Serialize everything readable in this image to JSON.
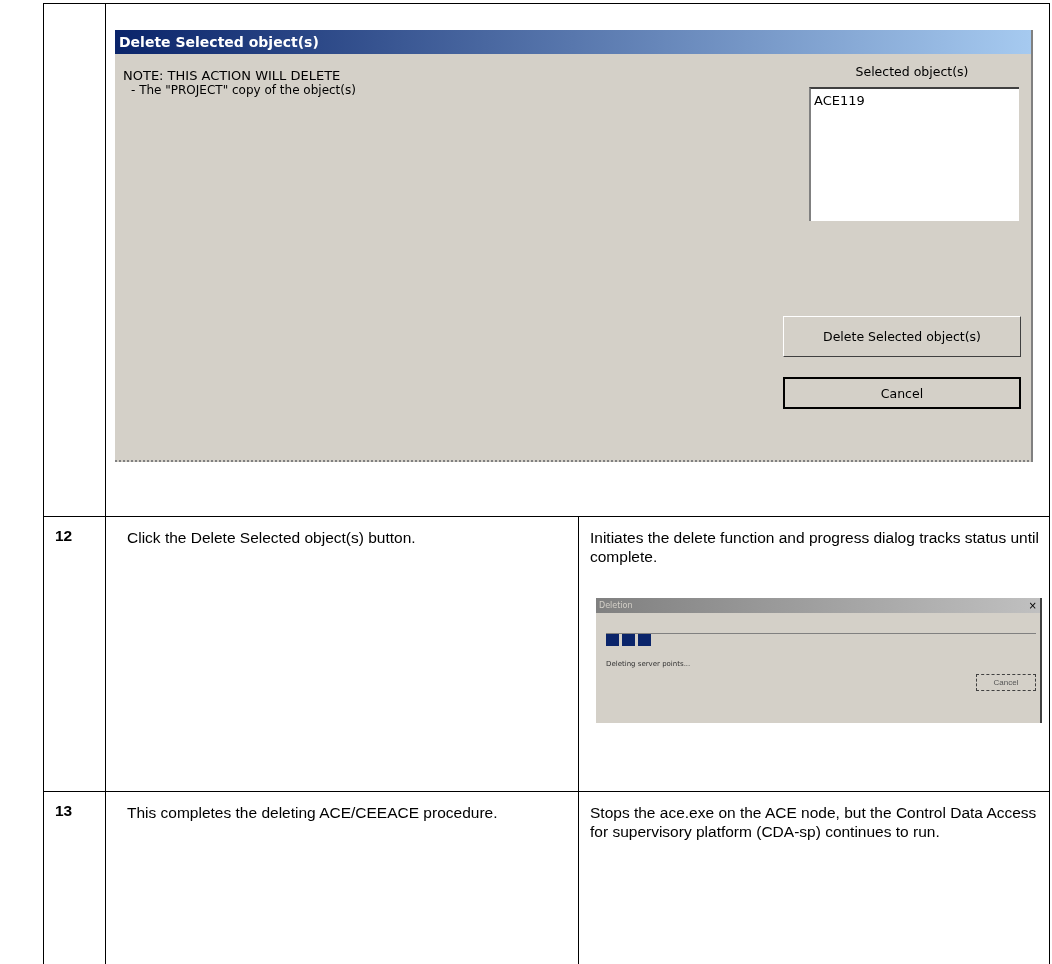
{
  "dialog": {
    "title": "Delete Selected object(s)",
    "note": "NOTE: THIS ACTION WILL DELETE",
    "note_detail": "- The \"PROJECT\" copy of the object(s)",
    "list_label": "Selected object(s)",
    "list_items": [
      "ACE119"
    ],
    "buttons": [
      {
        "label": "Delete Selected object(s)",
        "kind": "raised"
      },
      {
        "label": "Cancel",
        "kind": "default"
      }
    ]
  },
  "steps": [
    {
      "number": "12",
      "action": "Click the Delete Selected object(s) button.",
      "result": "Initiates the delete function and progress dialog tracks status until complete.",
      "progress_dialog": {
        "title": "Deletion",
        "close": "×",
        "level": 0.11,
        "status": "Deleting server points...",
        "button": "Cancel"
      }
    },
    {
      "number": "13",
      "action": "This completes the deleting ACE/CEEACE procedure.",
      "result": "Stops the ace.exe on the ACE node, but the Control Data Access for supervisory platform (CDA-sp) continues to run."
    }
  ]
}
